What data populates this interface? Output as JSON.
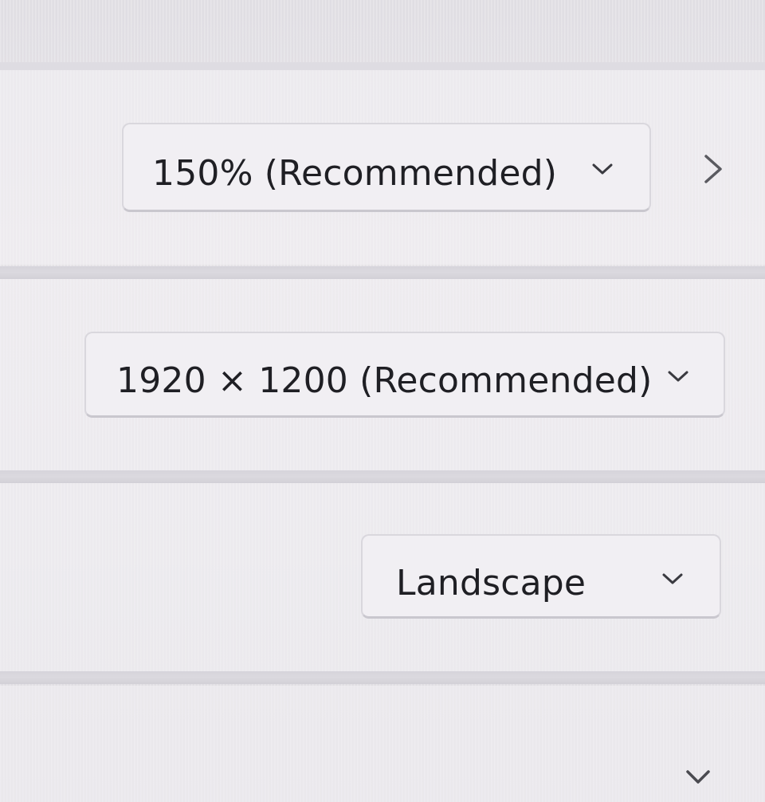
{
  "display_settings": {
    "scale": {
      "selected": "150% (Recommended)",
      "chevron_icon": "chevron-down-icon",
      "expand_icon": "chevron-right-icon"
    },
    "resolution": {
      "selected": "1920 × 1200 (Recommended)",
      "chevron_icon": "chevron-down-icon"
    },
    "orientation": {
      "selected": "Landscape",
      "chevron_icon": "chevron-down-icon"
    },
    "next_section": {
      "chevron_icon": "chevron-down-icon"
    }
  },
  "colors": {
    "background": "#e9e6ea",
    "dropdown_bg": "#f1eff3",
    "dropdown_border": "#d9d7dd",
    "text": "#1f1f24"
  }
}
